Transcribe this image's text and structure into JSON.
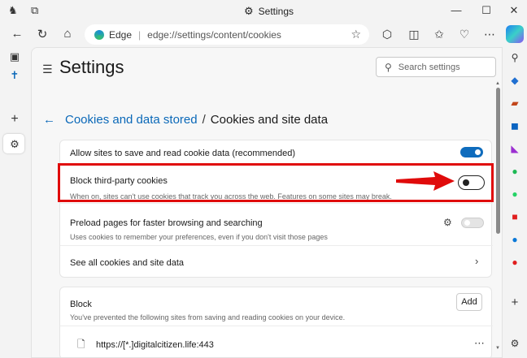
{
  "window": {
    "title": "Settings",
    "controls": {
      "minimize": "—",
      "maximize": "☐",
      "close": "✕"
    }
  },
  "toolbar": {
    "brand": "Edge",
    "separator": "|",
    "url": "edge://settings/content/cookies"
  },
  "settings": {
    "title": "Settings",
    "search_placeholder": "Search settings"
  },
  "breadcrumb": {
    "parent": "Cookies and data stored",
    "separator": "/",
    "current": "Cookies and site data"
  },
  "options": [
    {
      "label": "Allow sites to save and read cookie data (recommended)",
      "state": "on"
    },
    {
      "label": "Block third-party cookies",
      "description": "When on, sites can't use cookies that track you across the web. Features on some sites may break.",
      "state": "off"
    },
    {
      "label": "Preload pages for faster browsing and searching",
      "description": "Uses cookies to remember your preferences, even if you don't visit those pages",
      "state": "disabled"
    },
    {
      "label": "See all cookies and site data"
    }
  ],
  "block": {
    "title": "Block",
    "description": "You've prevented the following sites from saving and reading cookies on your device.",
    "add_label": "Add",
    "sites": [
      "https://[*.]digitalcitizen.life:443"
    ]
  },
  "colors": {
    "accent": "#0f6cbd",
    "link": "#0a68b8",
    "highlight": "#e00b0b"
  }
}
